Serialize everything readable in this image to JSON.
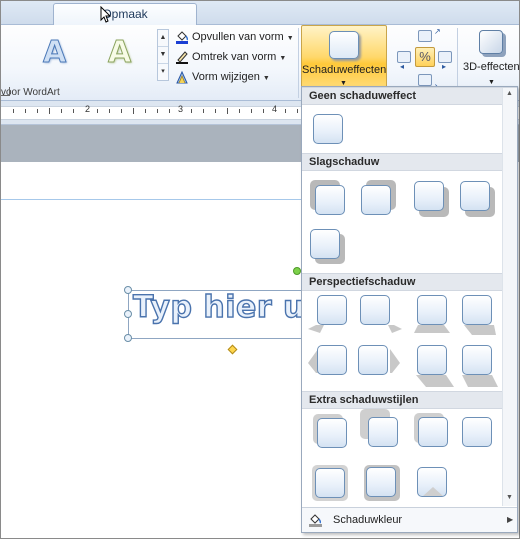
{
  "ribbon": {
    "active_tab": "Opmaak",
    "wordart_group_label": "voor WordArt",
    "commands": {
      "fill": "Opvullen van vorm",
      "outline": "Omtrek van vorm",
      "change": "Vorm wijzigen"
    },
    "shadow_button": "Schaduweffecten",
    "effects3d_button": "3D-effecten"
  },
  "ruler": {
    "numbers": [
      "2",
      "3",
      "4"
    ]
  },
  "document": {
    "wordart_text": "Typ hier u"
  },
  "dropdown": {
    "sections": [
      "Geen schaduweffect",
      "Slagschaduw",
      "Perspectiefschaduw",
      "Extra schaduwstijlen"
    ],
    "footer_label": "Schaduwkleur"
  },
  "colors": {
    "accent_gold": "#ffd15a",
    "ribbon_blue": "#dfe9f5",
    "wordart_outline": "#4a73ad"
  },
  "icons": [
    "fill-bucket-icon",
    "outline-pen-icon",
    "change-shape-icon",
    "shadow-icon",
    "nudge-icon",
    "3d-icon",
    "mouse-pointer-icon"
  ]
}
